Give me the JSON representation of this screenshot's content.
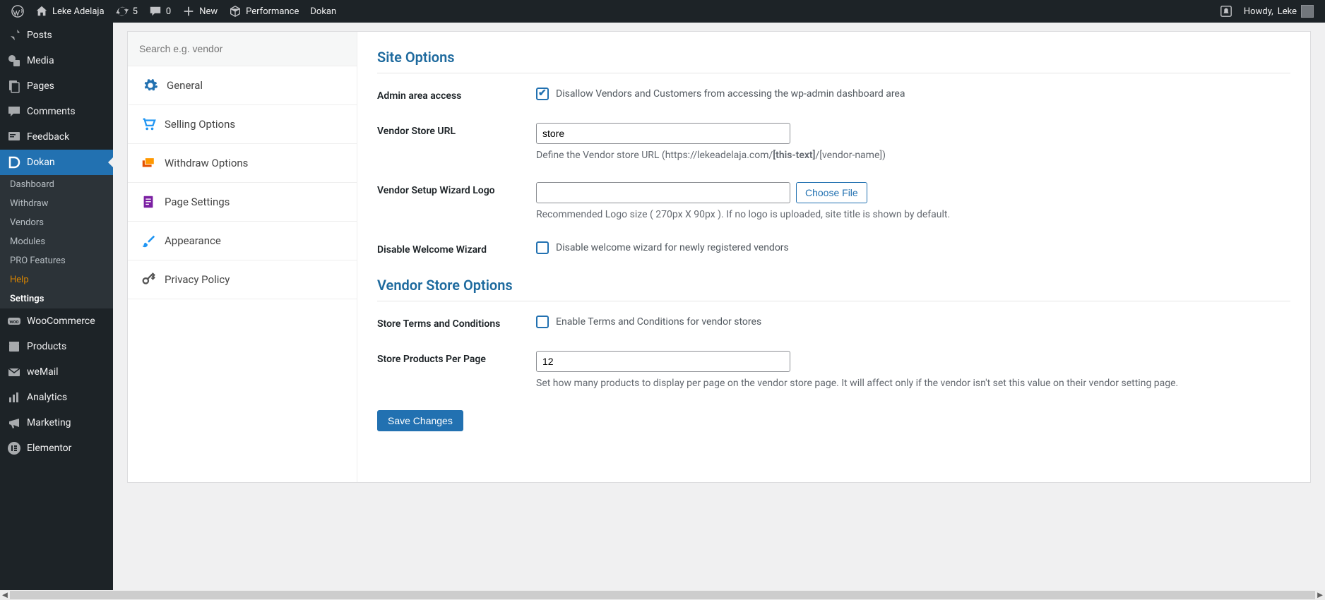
{
  "adminbar": {
    "site_name": "Leke Adelaja",
    "refresh_count": "5",
    "comments_count": "0",
    "new_label": "New",
    "performance_label": "Performance",
    "dokan_label": "Dokan",
    "howdy_prefix": "Howdy, ",
    "howdy_user": "Leke"
  },
  "menu": {
    "posts": "Posts",
    "media": "Media",
    "pages": "Pages",
    "comments": "Comments",
    "feedback": "Feedback",
    "dokan": "Dokan",
    "woocommerce": "WooCommerce",
    "products": "Products",
    "wemail": "weMail",
    "analytics": "Analytics",
    "marketing": "Marketing",
    "elementor": "Elementor",
    "dokan_sub": {
      "dashboard": "Dashboard",
      "withdraw": "Withdraw",
      "vendors": "Vendors",
      "modules": "Modules",
      "pro": "PRO Features",
      "help": "Help",
      "settings": "Settings"
    }
  },
  "settings_nav": {
    "search_placeholder": "Search e.g. vendor",
    "items": {
      "general": "General",
      "selling": "Selling Options",
      "withdraw": "Withdraw Options",
      "page": "Page Settings",
      "appearance": "Appearance",
      "privacy": "Privacy Policy"
    }
  },
  "form": {
    "section1_title": "Site Options",
    "admin_access_label": "Admin area access",
    "admin_access_text": "Disallow Vendors and Customers from accessing the wp-admin dashboard area",
    "vendor_url_label": "Vendor Store URL",
    "vendor_url_value": "store",
    "vendor_url_help_pre": "Define the Vendor store URL (https://lekeadelaja.com/",
    "vendor_url_help_bold": "[this-text]",
    "vendor_url_help_post": "/[vendor-name])",
    "wizard_logo_label": "Vendor Setup Wizard Logo",
    "choose_file_label": "Choose File",
    "wizard_logo_help": "Recommended Logo size ( 270px X 90px ). If no logo is uploaded, site title is shown by default.",
    "disable_wizard_label": "Disable Welcome Wizard",
    "disable_wizard_text": "Disable welcome wizard for newly registered vendors",
    "section2_title": "Vendor Store Options",
    "terms_label": "Store Terms and Conditions",
    "terms_text": "Enable Terms and Conditions for vendor stores",
    "ppp_label": "Store Products Per Page",
    "ppp_value": "12",
    "ppp_help": "Set how many products to display per page on the vendor store page. It will affect only if the vendor isn't set this value on their vendor setting page.",
    "save_label": "Save Changes"
  }
}
